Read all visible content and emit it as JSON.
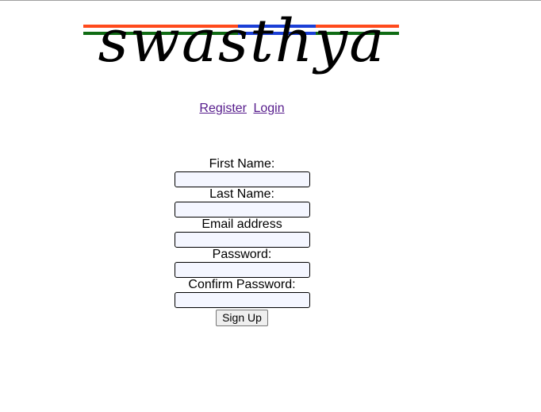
{
  "brand": {
    "logo_text": "swasthya",
    "stripe_colors": [
      "#ff4a1c",
      "#1b3fd6",
      "#0f6b13"
    ]
  },
  "nav": {
    "register_label": "Register",
    "login_label": "Login"
  },
  "form": {
    "first_name_label": "First Name:",
    "last_name_label": "Last Name:",
    "email_label": "Email address",
    "password_label": "Password:",
    "confirm_password_label": "Confirm Password:",
    "first_name_value": "",
    "last_name_value": "",
    "email_value": "",
    "password_value": "",
    "confirm_password_value": "",
    "submit_label": "Sign Up"
  }
}
